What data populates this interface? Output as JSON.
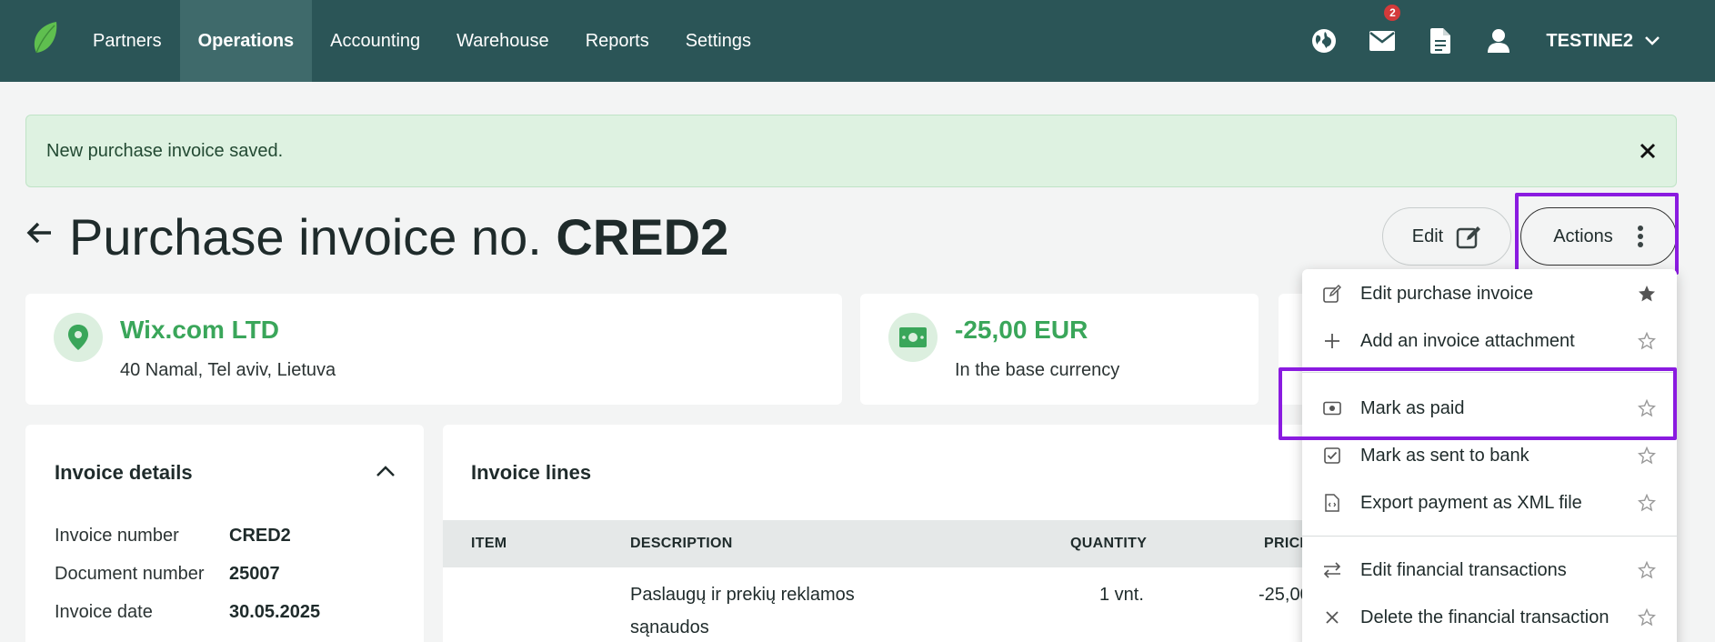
{
  "nav": {
    "items": [
      {
        "label": "Partners"
      },
      {
        "label": "Operations"
      },
      {
        "label": "Accounting"
      },
      {
        "label": "Warehouse"
      },
      {
        "label": "Reports"
      },
      {
        "label": "Settings"
      }
    ],
    "active": "Operations",
    "mail_badge": "2",
    "company": "TESTINE2",
    "icons": [
      "globe-icon",
      "mail-icon",
      "document-icon",
      "user-icon",
      "chevron-down-icon"
    ]
  },
  "alert": {
    "text": "New purchase invoice saved."
  },
  "page": {
    "title_prefix": "Purchase invoice no.",
    "title_number": "CRED2",
    "edit_label": "Edit",
    "actions_label": "Actions"
  },
  "partner_card": {
    "name": "Wix.com LTD",
    "address": "40 Namal, Tel aviv, Lietuva"
  },
  "amount_card": {
    "amount": "-25,00 EUR",
    "caption": "In the base currency"
  },
  "details": {
    "title": "Invoice details",
    "rows": [
      {
        "label": "Invoice number",
        "value": "CRED2"
      },
      {
        "label": "Document number",
        "value": "25007"
      },
      {
        "label": "Invoice date",
        "value": "30.05.2025"
      }
    ]
  },
  "lines": {
    "title": "Invoice lines",
    "columns": [
      "ITEM",
      "DESCRIPTION",
      "QUANTITY",
      "PRICE"
    ],
    "rows": [
      {
        "item": "",
        "description_1": "Paslaugų ir prekių reklamos",
        "description_2": "sąnaudos",
        "quantity": "1 vnt.",
        "price": "-25,00"
      }
    ]
  },
  "menu": {
    "items": [
      {
        "label": "Edit purchase invoice",
        "icon": "pencil-icon",
        "starred": true
      },
      {
        "label": "Add an invoice attachment",
        "icon": "plus-icon",
        "starred": false
      },
      {
        "label": "Mark as paid",
        "icon": "money-icon",
        "starred": false
      },
      {
        "label": "Mark as sent to bank",
        "icon": "checkbox-icon",
        "starred": false
      },
      {
        "label": "Export payment as XML file",
        "icon": "file-code-icon",
        "starred": false
      },
      {
        "label": "Edit financial transactions",
        "icon": "arrows-exchange-icon",
        "starred": false
      },
      {
        "label": "Delete the financial transaction",
        "icon": "close-icon",
        "starred": false
      }
    ]
  },
  "colors": {
    "nav_bg": "#2b5557",
    "nav_active": "#3f6a6b",
    "accent_green": "#3aa65a",
    "alert_bg": "#def2e1",
    "highlight": "#8a1be0"
  }
}
